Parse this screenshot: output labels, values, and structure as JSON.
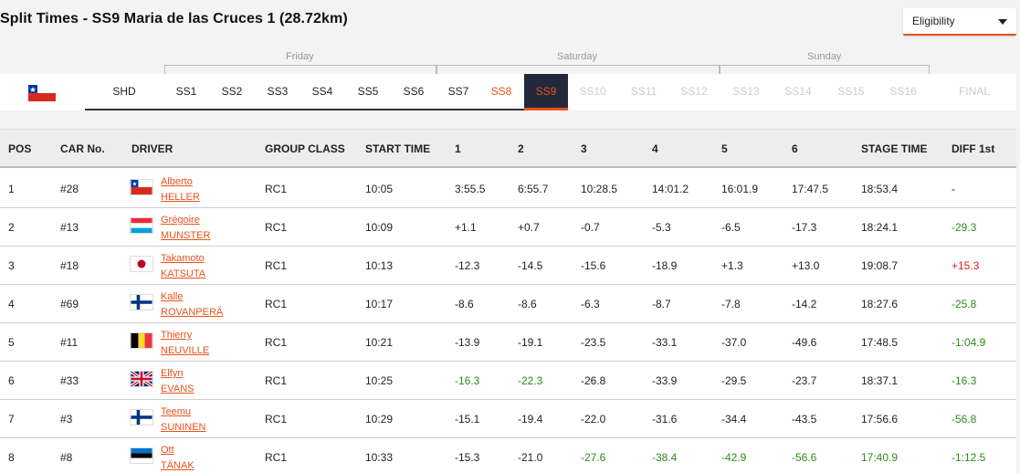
{
  "title": "Split Times - SS9 Maria de las Cruces 1 (28.72km)",
  "eligibility": {
    "label": "Eligibility"
  },
  "days": [
    "Friday",
    "Saturday",
    "Sunday"
  ],
  "stages": {
    "shd": "SHD",
    "ss1": "SS1",
    "ss2": "SS2",
    "ss3": "SS3",
    "ss4": "SS4",
    "ss5": "SS5",
    "ss6": "SS6",
    "ss7": "SS7",
    "ss8": "SS8",
    "ss9": "SS9",
    "ss10": "SS10",
    "ss11": "SS11",
    "ss12": "SS12",
    "ss13": "SS13",
    "ss14": "SS14",
    "ss15": "SS15",
    "ss16": "SS16",
    "final": "FINAL"
  },
  "headers": {
    "pos": "POS",
    "car": "CAR No.",
    "driver": "DRIVER",
    "group": "GROUP CLASS",
    "start": "START TIME",
    "s1": "1",
    "s2": "2",
    "s3": "3",
    "s4": "4",
    "s5": "5",
    "s6": "6",
    "stage_time": "STAGE TIME",
    "diff": "DIFF 1st"
  },
  "rows": [
    {
      "pos": "1",
      "car": "#28",
      "first": "Alberto",
      "last": "HELLER",
      "flag": "chile",
      "group": "RC1",
      "start": "10:05",
      "s1": "3:55.5",
      "s2": "6:55.7",
      "s3": "10:28.5",
      "s4": "14:01.2",
      "s5": "16:01.9",
      "s6": "17:47.5",
      "stage": "18:53.4",
      "diff": "-"
    },
    {
      "pos": "2",
      "car": "#13",
      "first": "Grégoire",
      "last": "MUNSTER",
      "flag": "luxembourg",
      "group": "RC1",
      "start": "10:09",
      "s1": "+1.1",
      "s2": "+0.7",
      "s3": "-0.7",
      "s4": "-5.3",
      "s5": "-6.5",
      "s6": "-17.3",
      "stage": "18:24.1",
      "diff": "-29.3"
    },
    {
      "pos": "3",
      "car": "#18",
      "first": "Takamoto",
      "last": "KATSUTA",
      "flag": "japan",
      "group": "RC1",
      "start": "10:13",
      "s1": "-12.3",
      "s2": "-14.5",
      "s3": "-15.6",
      "s4": "-18.9",
      "s5": "+1.3",
      "s6": "+13.0",
      "stage": "19:08.7",
      "diff": "+15.3"
    },
    {
      "pos": "4",
      "car": "#69",
      "first": "Kalle",
      "last": "ROVANPERÄ",
      "flag": "finland",
      "group": "RC1",
      "start": "10:17",
      "s1": "-8.6",
      "s2": "-8.6",
      "s3": "-6.3",
      "s4": "-8.7",
      "s5": "-7.8",
      "s6": "-14.2",
      "stage": "18:27.6",
      "diff": "-25.8"
    },
    {
      "pos": "5",
      "car": "#11",
      "first": "Thierry",
      "last": "NEUVILLE",
      "flag": "belgium",
      "group": "RC1",
      "start": "10:21",
      "s1": "-13.9",
      "s2": "-19.1",
      "s3": "-23.5",
      "s4": "-33.1",
      "s5": "-37.0",
      "s6": "-49.6",
      "stage": "17:48.5",
      "diff": "-1:04.9"
    },
    {
      "pos": "6",
      "car": "#33",
      "first": "Elfyn",
      "last": "EVANS",
      "flag": "uk",
      "group": "RC1",
      "start": "10:25",
      "s1": "-16.3",
      "s2": "-22.3",
      "s3": "-26.8",
      "s4": "-33.9",
      "s5": "-29.5",
      "s6": "-23.7",
      "stage": "18:37.1",
      "diff": "-16.3"
    },
    {
      "pos": "7",
      "car": "#3",
      "first": "Teemu",
      "last": "SUNINEN",
      "flag": "finland",
      "group": "RC1",
      "start": "10:29",
      "s1": "-15.1",
      "s2": "-19.4",
      "s3": "-22.0",
      "s4": "-31.6",
      "s5": "-34.4",
      "s6": "-43.5",
      "stage": "17:56.6",
      "diff": "-56.8"
    },
    {
      "pos": "8",
      "car": "#8",
      "first": "Ott",
      "last": "TÄNAK",
      "flag": "estonia",
      "group": "RC1",
      "start": "10:33",
      "s1": "-15.3",
      "s2": "-21.0",
      "s3": "-27.6",
      "s4": "-38.4",
      "s5": "-42.9",
      "s6": "-56.6",
      "stage": "17:40.9",
      "diff": "-1:12.5"
    }
  ],
  "colors": {
    "accent": "#e8521c",
    "positive": "#2e8b1c",
    "negative": "#e02020",
    "active_tab": "#23283b"
  }
}
